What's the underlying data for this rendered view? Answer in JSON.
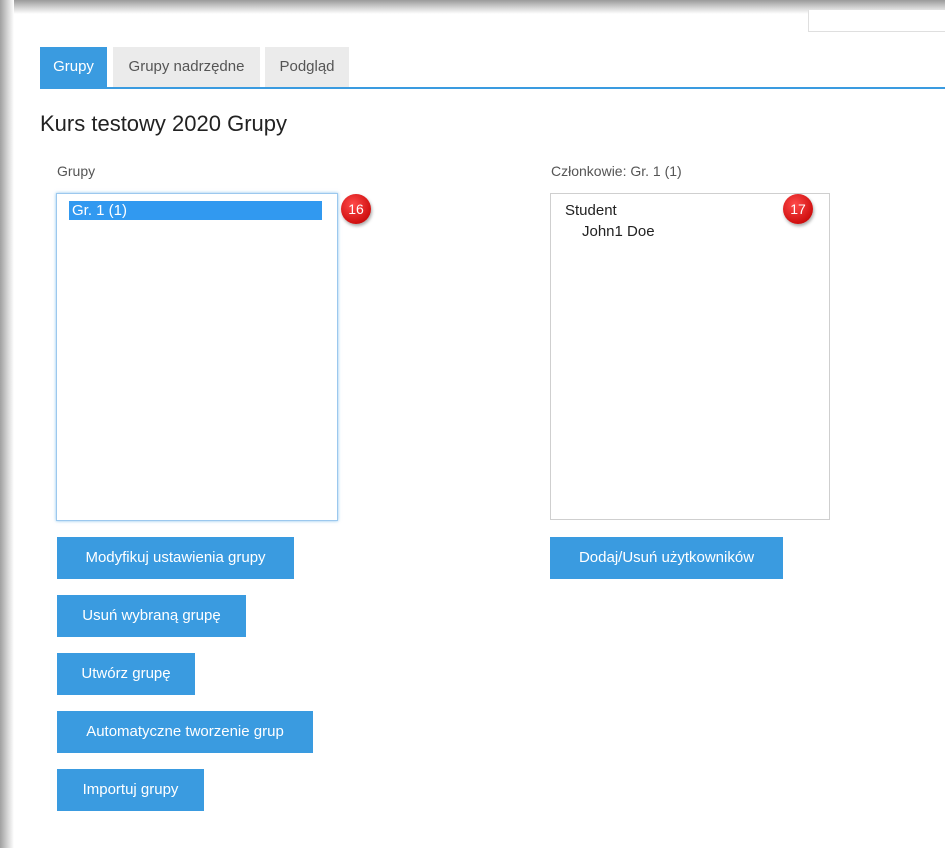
{
  "tabs": [
    {
      "label": "Grupy",
      "active": true
    },
    {
      "label": "Grupy nadrzędne",
      "active": false
    },
    {
      "label": "Podgląd",
      "active": false
    }
  ],
  "page_title": "Kurs testowy 2020 Grupy",
  "groups_panel": {
    "label": "Grupy",
    "options": [
      "Gr. 1 (1)"
    ],
    "selected": "Gr. 1 (1)",
    "badge": "16"
  },
  "members_panel": {
    "label": "Członkowie: Gr. 1 (1)",
    "role": "Student",
    "members": [
      "John1 Doe"
    ],
    "badge": "17"
  },
  "buttons": {
    "edit_group": "Modyfikuj ustawienia grupy",
    "delete_group": "Usuń wybraną grupę",
    "create_group": "Utwórz grupę",
    "auto_create": "Automatyczne tworzenie grup",
    "import_groups": "Importuj grupy",
    "add_remove_users": "Dodaj/Usuń użytkowników"
  },
  "colors": {
    "accent": "#3a9be0",
    "selection": "#3199f0",
    "badge": "#d01010"
  }
}
